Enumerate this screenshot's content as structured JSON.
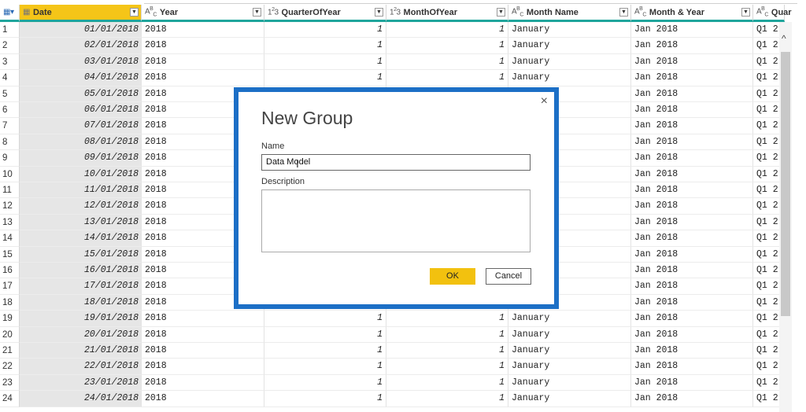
{
  "columns": [
    {
      "id": "corner",
      "label": "",
      "type_icon": "table-icon"
    },
    {
      "id": "date",
      "label": "Date",
      "type_icon": "calendar-icon",
      "selected": true
    },
    {
      "id": "year",
      "label": "Year",
      "type_icon": "A^B_C"
    },
    {
      "id": "qoy",
      "label": "QuarterOfYear",
      "type_icon": "1²3"
    },
    {
      "id": "moy",
      "label": "MonthOfYear",
      "type_icon": "1²3"
    },
    {
      "id": "mname",
      "label": "Month Name",
      "type_icon": "A^B_C"
    },
    {
      "id": "myear",
      "label": "Month & Year",
      "type_icon": "A^B_C"
    },
    {
      "id": "quar",
      "label": "Quar",
      "type_icon": "A^B_C"
    }
  ],
  "rows": [
    [
      "1",
      "01/01/2018",
      "2018",
      "1",
      "1",
      "January",
      "Jan 2018",
      "Q1 2"
    ],
    [
      "2",
      "02/01/2018",
      "2018",
      "1",
      "1",
      "January",
      "Jan 2018",
      "Q1 2"
    ],
    [
      "3",
      "03/01/2018",
      "2018",
      "1",
      "1",
      "January",
      "Jan 2018",
      "Q1 2"
    ],
    [
      "4",
      "04/01/2018",
      "2018",
      "1",
      "1",
      "January",
      "Jan 2018",
      "Q1 2"
    ],
    [
      "5",
      "05/01/2018",
      "2018",
      "",
      "",
      "",
      "Jan 2018",
      "Q1 2"
    ],
    [
      "6",
      "06/01/2018",
      "2018",
      "",
      "",
      "",
      "Jan 2018",
      "Q1 2"
    ],
    [
      "7",
      "07/01/2018",
      "2018",
      "",
      "",
      "",
      "Jan 2018",
      "Q1 2"
    ],
    [
      "8",
      "08/01/2018",
      "2018",
      "",
      "",
      "",
      "Jan 2018",
      "Q1 2"
    ],
    [
      "9",
      "09/01/2018",
      "2018",
      "",
      "",
      "",
      "Jan 2018",
      "Q1 2"
    ],
    [
      "10",
      "10/01/2018",
      "2018",
      "",
      "",
      "",
      "Jan 2018",
      "Q1 2"
    ],
    [
      "11",
      "11/01/2018",
      "2018",
      "",
      "",
      "",
      "Jan 2018",
      "Q1 2"
    ],
    [
      "12",
      "12/01/2018",
      "2018",
      "",
      "",
      "",
      "Jan 2018",
      "Q1 2"
    ],
    [
      "13",
      "13/01/2018",
      "2018",
      "",
      "",
      "",
      "Jan 2018",
      "Q1 2"
    ],
    [
      "14",
      "14/01/2018",
      "2018",
      "",
      "",
      "",
      "Jan 2018",
      "Q1 2"
    ],
    [
      "15",
      "15/01/2018",
      "2018",
      "",
      "",
      "",
      "Jan 2018",
      "Q1 2"
    ],
    [
      "16",
      "16/01/2018",
      "2018",
      "",
      "",
      "",
      "Jan 2018",
      "Q1 2"
    ],
    [
      "17",
      "17/01/2018",
      "2018",
      "",
      "",
      "",
      "Jan 2018",
      "Q1 2"
    ],
    [
      "18",
      "18/01/2018",
      "2018",
      "",
      "",
      "",
      "Jan 2018",
      "Q1 2"
    ],
    [
      "19",
      "19/01/2018",
      "2018",
      "1",
      "1",
      "January",
      "Jan 2018",
      "Q1 2"
    ],
    [
      "20",
      "20/01/2018",
      "2018",
      "1",
      "1",
      "January",
      "Jan 2018",
      "Q1 2"
    ],
    [
      "21",
      "21/01/2018",
      "2018",
      "1",
      "1",
      "January",
      "Jan 2018",
      "Q1 2"
    ],
    [
      "22",
      "22/01/2018",
      "2018",
      "1",
      "1",
      "January",
      "Jan 2018",
      "Q1 2"
    ],
    [
      "23",
      "23/01/2018",
      "2018",
      "1",
      "1",
      "January",
      "Jan 2018",
      "Q1 2"
    ],
    [
      "24",
      "24/01/2018",
      "2018",
      "1",
      "1",
      "January",
      "Jan 2018",
      "Q1 2"
    ]
  ],
  "dialog": {
    "title": "New Group",
    "name_label": "Name",
    "name_value": "Data Model",
    "description_label": "Description",
    "description_value": "",
    "ok_label": "OK",
    "cancel_label": "Cancel",
    "close_glyph": "×"
  },
  "colors": {
    "accent": "#1c6fc6",
    "header_selected": "#f5c518",
    "ok_button": "#f2c10f",
    "header_underline": "#1fa59c"
  }
}
